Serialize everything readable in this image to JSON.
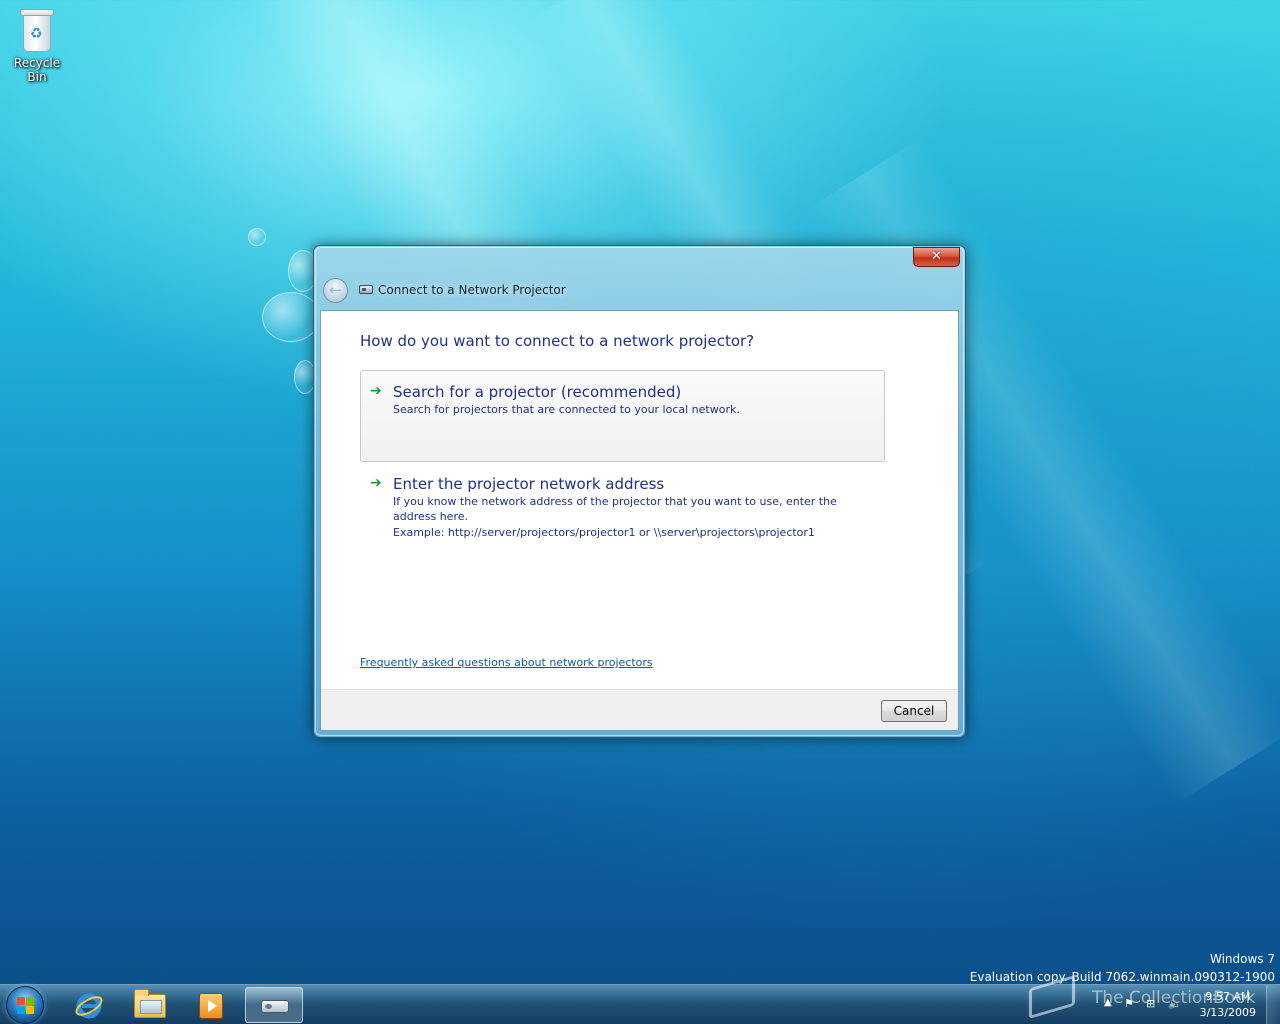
{
  "desktop": {
    "recycle_bin_label": "Recycle Bin",
    "watermark": {
      "line1": "Windows 7",
      "line2": "Evaluation copy. Build 7062.winmain.090312-1900"
    },
    "site_watermark": "The CollectionBook"
  },
  "dialog": {
    "title": "Connect to a Network Projector",
    "close_glyph": "✕",
    "back_glyph": "←",
    "heading": "How do you want to connect to a network projector?",
    "options": [
      {
        "title": "Search for a projector (recommended)",
        "description": "Search for projectors that are connected to your local network."
      },
      {
        "title": "Enter the projector network address",
        "description": "If you know the network address of the projector that you want to use, enter the address here.",
        "example": "Example: http://server/projectors/projector1 or \\\\server\\projectors\\projector1"
      }
    ],
    "faq_link": "Frequently asked questions about network projectors",
    "cancel_label": "Cancel"
  },
  "taskbar": {
    "pinned": [
      "internet-explorer-icon",
      "windows-explorer-icon",
      "media-player-icon",
      "network-projector-icon"
    ],
    "active_item": "network-projector-icon",
    "clock_time": "9:57 AM",
    "clock_date": "3/13/2009",
    "tray_show_hidden_glyph": "▲",
    "tray_flag_glyph": "⚑",
    "tray_network_glyph": "⊞",
    "tray_volume_glyph": "🔈"
  },
  "colors": {
    "heading_blue": "#1e3287",
    "link_blue": "#0b5aa8",
    "arrow_green": "#1d9a2c",
    "close_red": "#c0301a"
  }
}
